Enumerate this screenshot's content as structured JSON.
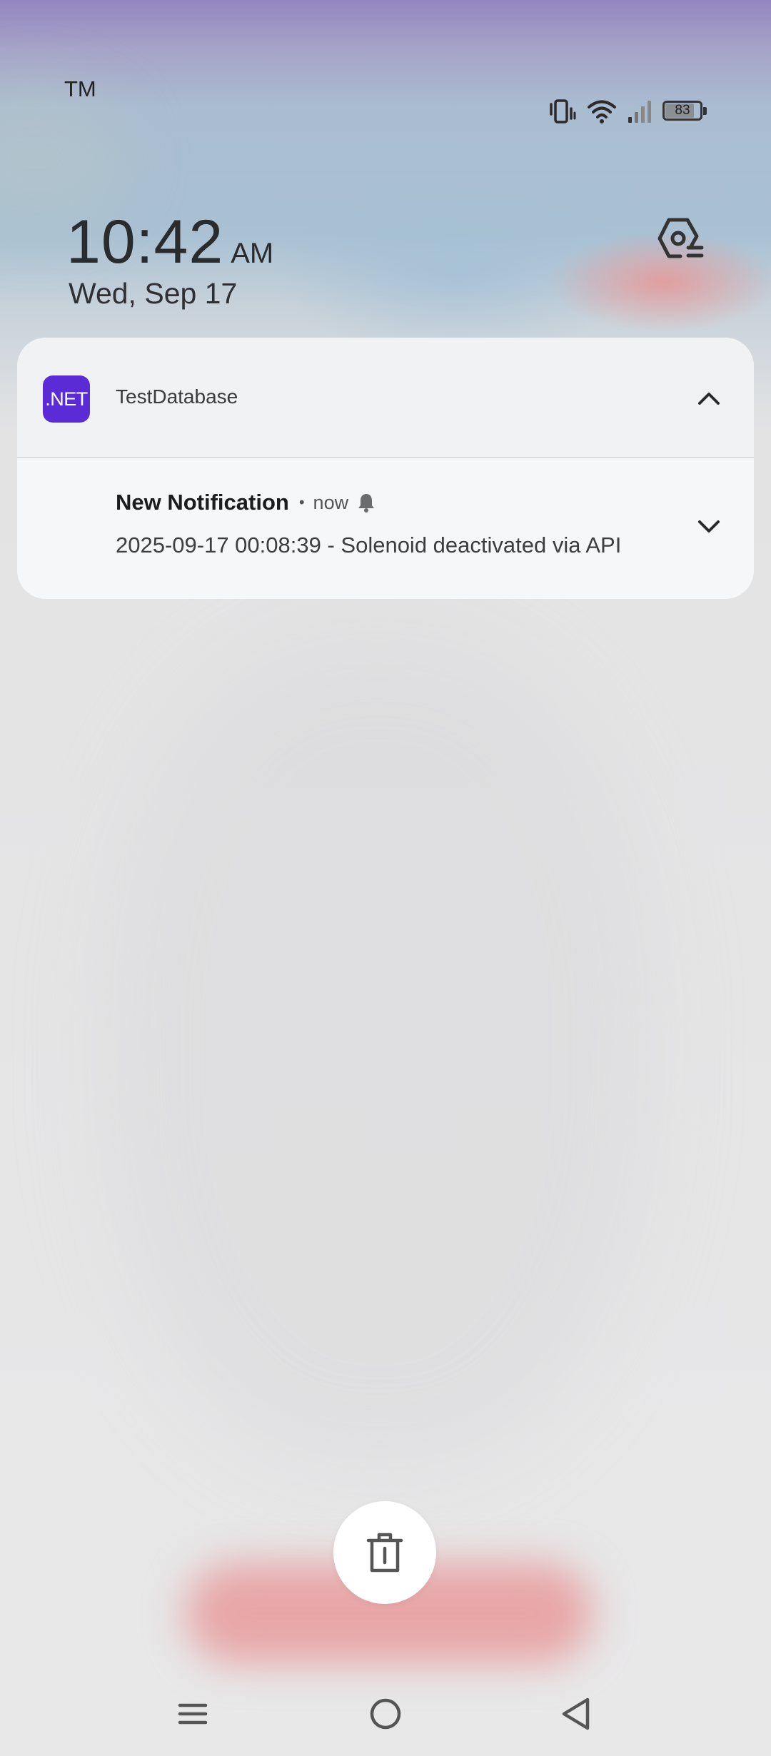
{
  "status_bar": {
    "carrier": "TM",
    "battery_percent": "83",
    "icons": [
      "vibrate-icon",
      "wifi-icon",
      "signal-icon",
      "battery-icon"
    ]
  },
  "lock_clock": {
    "time": "10:42",
    "ampm": "AM",
    "date": "Wed, Sep 17"
  },
  "notification": {
    "app_icon_text": ".NET",
    "app_name": "TestDatabase",
    "title": "New Notification",
    "separator": "•",
    "time": "now",
    "body": "2025-09-17 00:08:39 - Solenoid deactivated via API",
    "accent_color": "#5b2bd5"
  },
  "actions": {
    "clear_icon": "trash-icon"
  },
  "nav_bar": {
    "buttons": [
      "menu-icon",
      "home-icon",
      "back-icon"
    ]
  }
}
